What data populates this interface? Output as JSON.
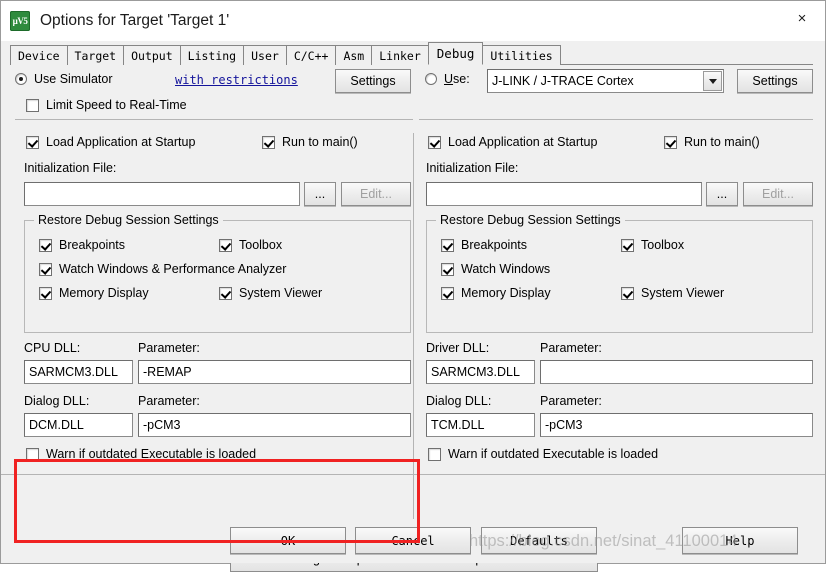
{
  "window": {
    "title": "Options for Target 'Target 1'",
    "app_icon": "keil-uvision-icon",
    "app_icon_text": "µV5",
    "close_icon": "×"
  },
  "tabs": [
    {
      "label": "Device",
      "selected": false
    },
    {
      "label": "Target",
      "selected": false
    },
    {
      "label": "Output",
      "selected": false
    },
    {
      "label": "Listing",
      "selected": false
    },
    {
      "label": "User",
      "selected": false
    },
    {
      "label": "C/C++",
      "selected": false
    },
    {
      "label": "Asm",
      "selected": false
    },
    {
      "label": "Linker",
      "selected": false
    },
    {
      "label": "Debug",
      "selected": true
    },
    {
      "label": "Utilities",
      "selected": false
    }
  ],
  "left_pane": {
    "use_simulator": {
      "label": "Use Simulator",
      "checked": true
    },
    "restrictions_link": "with restrictions",
    "settings_button": "Settings",
    "limit_speed": {
      "label": "Limit Speed to Real-Time",
      "checked": false
    },
    "load_app_at_startup": {
      "label": "Load Application at Startup",
      "checked": true
    },
    "run_to_main": {
      "label": "Run to main()",
      "checked": true
    },
    "init_file_label": "Initialization File:",
    "init_file_value": "",
    "browse_button": "...",
    "edit_button": "Edit...",
    "restore_group_title": "Restore Debug Session Settings",
    "restore_items": [
      {
        "label": "Breakpoints",
        "checked": true
      },
      {
        "label": "Toolbox",
        "checked": true
      },
      {
        "label": "Watch Windows & Performance Analyzer",
        "checked": true
      },
      {
        "label": "Memory Display",
        "checked": true
      },
      {
        "label": "System Viewer",
        "checked": true
      }
    ],
    "cpu_dll_label": "CPU DLL:",
    "cpu_dll_value": "SARMCM3.DLL",
    "cpu_param_label": "Parameter:",
    "cpu_param_value": "-REMAP",
    "dialog_dll_label": "Dialog DLL:",
    "dialog_dll_value": "DCM.DLL",
    "dialog_param_label": "Parameter:",
    "dialog_param_value": "-pCM3",
    "warn_outdated": {
      "label": "Warn if outdated Executable is loaded",
      "checked": false
    }
  },
  "right_pane": {
    "use_driver": {
      "label": "Use:",
      "label_prefix": "U",
      "label_rest": "se:",
      "checked": false
    },
    "driver_combo_value": "J-LINK / J-TRACE Cortex",
    "settings_button": "Settings",
    "load_app_at_startup": {
      "label": "Load Application at Startup",
      "checked": true
    },
    "run_to_main": {
      "label": "Run to main()",
      "checked": true
    },
    "init_file_label": "Initialization File:",
    "init_file_value": "",
    "browse_button": "...",
    "edit_button": "Edit...",
    "restore_group_title": "Restore Debug Session Settings",
    "restore_items": [
      {
        "label": "Breakpoints",
        "checked": true
      },
      {
        "label": "Toolbox",
        "checked": true
      },
      {
        "label": "Watch Windows",
        "checked": true
      },
      {
        "label": "Memory Display",
        "checked": true
      },
      {
        "label": "System Viewer",
        "checked": true
      }
    ],
    "driver_dll_label": "Driver DLL:",
    "driver_dll_value": "SARMCM3.DLL",
    "driver_param_label": "Parameter:",
    "driver_param_value": "",
    "dialog_dll_label": "Dialog DLL:",
    "dialog_dll_value": "TCM.DLL",
    "dialog_param_label": "Parameter:",
    "dialog_param_value": "-pCM3",
    "warn_outdated": {
      "label": "Warn if outdated Executable is loaded",
      "checked": false
    }
  },
  "manage_button": "Manage Component Viewer Description Files ...",
  "footer_buttons": {
    "ok": "OK",
    "cancel": "Cancel",
    "defaults": "Defaults",
    "help": "Help"
  },
  "annotation": {
    "highlight_color": "#f02222"
  },
  "watermark": "https://blog.csdn.net/sinat_41100014"
}
